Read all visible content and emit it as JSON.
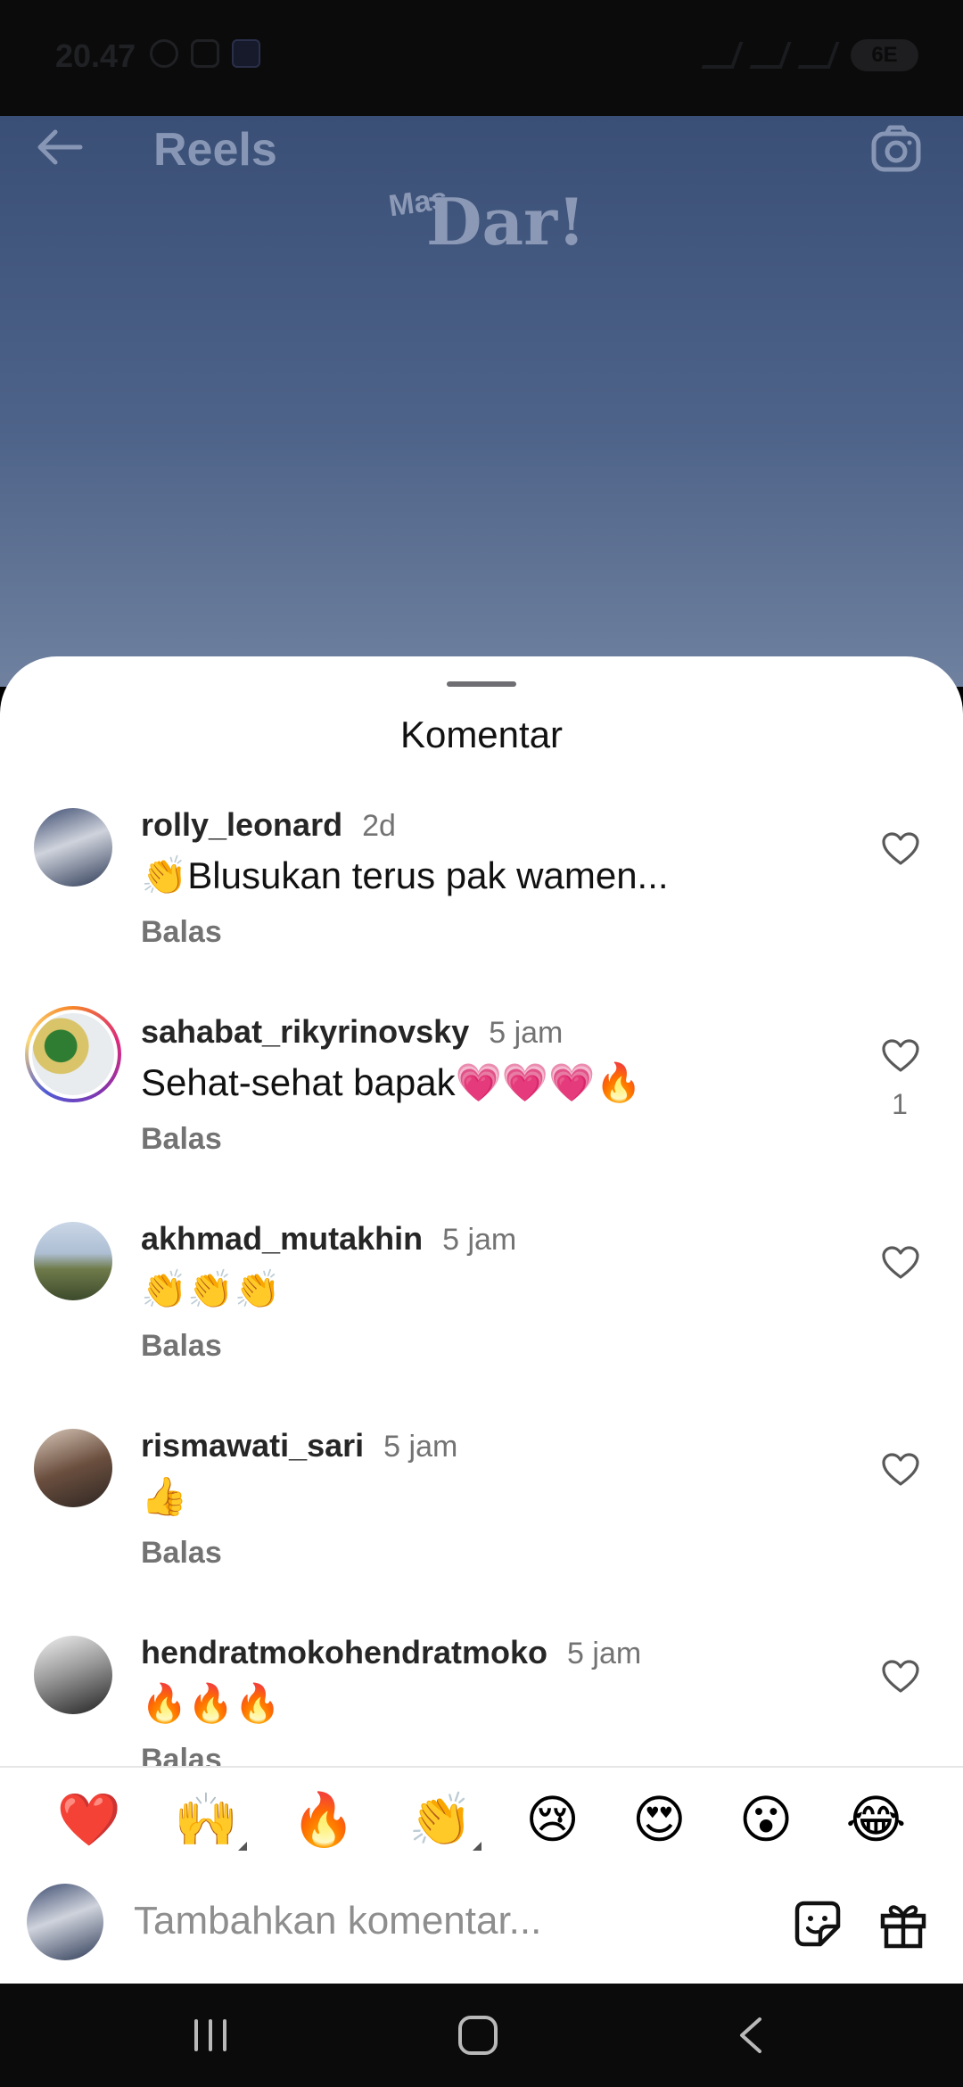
{
  "status_bar": {
    "time": "20.47",
    "battery": "6E"
  },
  "header": {
    "title": "Reels"
  },
  "video_overlay": {
    "logo_small": "Mas",
    "logo_large": "Dar!"
  },
  "sheet": {
    "title": "Komentar",
    "comments": [
      {
        "user": "rolly_leonard",
        "time": "2d",
        "text": "👏Blusukan terus pak wamen...",
        "reply": "Balas",
        "likes": ""
      },
      {
        "user": "sahabat_rikyrinovsky",
        "time": "5 jam",
        "text": "Sehat-sehat bapak💗💗💗🔥",
        "reply": "Balas",
        "likes": "1"
      },
      {
        "user": "akhmad_mutakhin",
        "time": "5 jam",
        "text": "👏👏👏",
        "reply": "Balas",
        "likes": ""
      },
      {
        "user": "rismawati_sari",
        "time": "5 jam",
        "text": "👍",
        "reply": "Balas",
        "likes": ""
      },
      {
        "user": "hendratmokohendratmoko",
        "time": "5 jam",
        "text": "🔥🔥🔥",
        "reply": "Balas",
        "likes": ""
      }
    ]
  },
  "reactions": [
    "❤️",
    "🙌",
    "🔥",
    "👏",
    "😢",
    "😍",
    "😮",
    "😂"
  ],
  "composer": {
    "placeholder": "Tambahkan komentar..."
  },
  "colors": {
    "heart_red": "#ed4956",
    "text_secondary": "#737373",
    "video_blue": "#3a4f76"
  }
}
